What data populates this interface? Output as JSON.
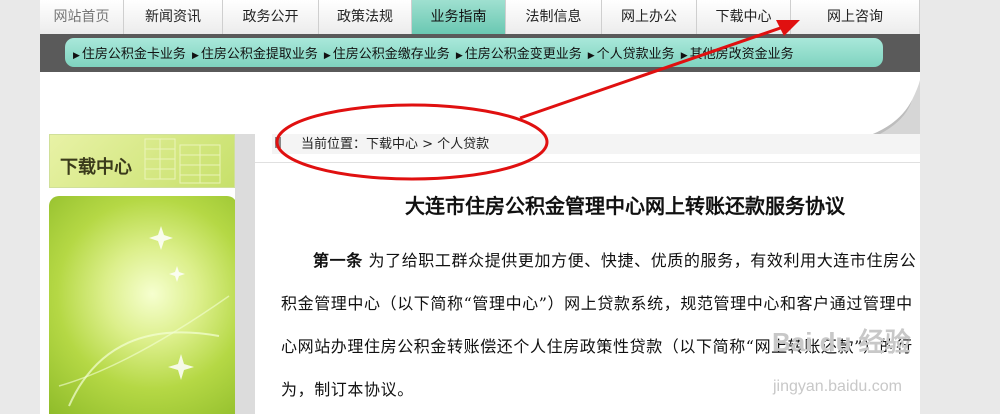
{
  "topnav": {
    "items": [
      {
        "label": "网站首页"
      },
      {
        "label": "新闻资讯"
      },
      {
        "label": "政务公开"
      },
      {
        "label": "政策法规"
      },
      {
        "label": "业务指南"
      },
      {
        "label": "法制信息"
      },
      {
        "label": "网上办公"
      },
      {
        "label": "下载中心"
      },
      {
        "label": "网上咨询"
      }
    ],
    "active_index": 4
  },
  "subnav": {
    "items": [
      {
        "label": "住房公积金卡业务"
      },
      {
        "label": "住房公积金提取业务"
      },
      {
        "label": "住房公积金缴存业务"
      },
      {
        "label": "住房公积金变更业务"
      },
      {
        "label": "个人贷款业务"
      },
      {
        "label": "其他房改资金业务"
      }
    ]
  },
  "sidebar": {
    "title": "下载中心"
  },
  "breadcrumb": {
    "text": "当前位置：下载中心 > 个人贷款"
  },
  "document": {
    "title": "大连市住房公积金管理中心网上转账还款服务协议",
    "article_label": "第一条",
    "article_text": "为了给职工群众提供更加方便、快捷、优质的服务，有效利用大连市住房公积金管理中心（以下简称“管理中心”）网上贷款系统，规范管理中心和客户通过管理中心网站办理住房公积金转账偿还个人住房政策性贷款（以下简称“网上转账还款”）的行为，制订本协议。"
  },
  "watermark": {
    "brand": "Bai du 经验",
    "url": "jingyan.baidu.com"
  },
  "colors": {
    "annotation": "#e01010",
    "active_tab": "#6ac8b2",
    "subnav_bg": "#a9e8da"
  }
}
